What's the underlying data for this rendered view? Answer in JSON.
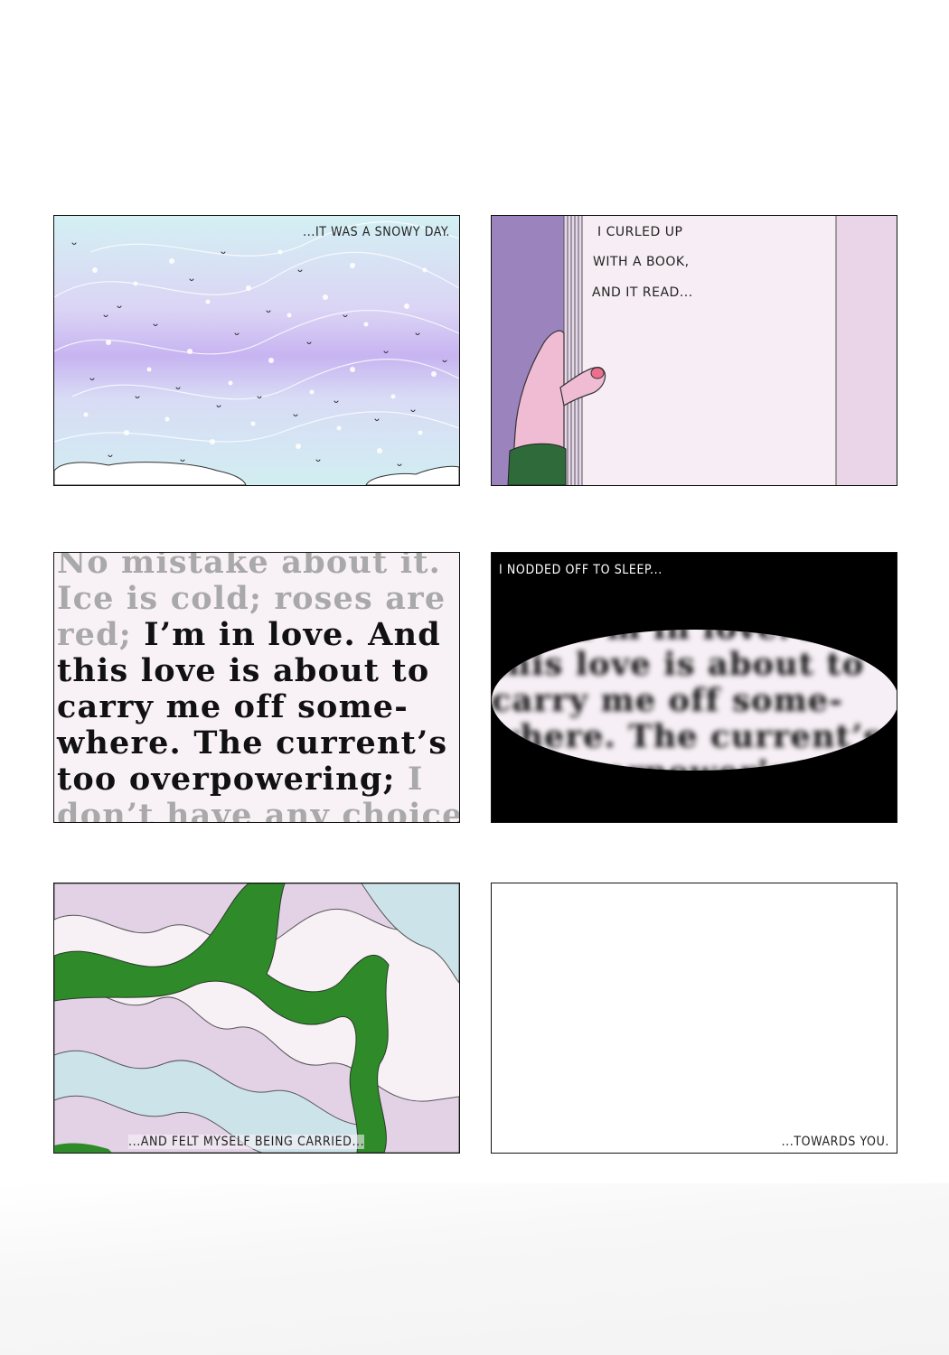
{
  "panels": {
    "snowy": {
      "caption": "...IT WAS A SNOWY DAY."
    },
    "book": {
      "lines": [
        "I CURLED UP",
        "WITH A BOOK,",
        "AND IT READ..."
      ]
    },
    "story": {
      "lines": [
        "No mistake about it.",
        "Ice is cold; roses are",
        "red; I’m in love. And",
        "this love is about to",
        "carry me off  some-",
        "where.  The current’s",
        "too overpowering; I",
        "don’t have any choice"
      ]
    },
    "sleep": {
      "caption": "I NODDED OFF TO SLEEP...",
      "lines": [
        "red; I’m in love. And",
        "this love is about to",
        "carry me off  some-",
        "where.  The current’s",
        "too overpowering; I"
      ]
    },
    "carried": {
      "caption": "...AND FELT MYSELF BEING CARRIED..."
    },
    "towards": {
      "caption": "...TOWARDS YOU."
    }
  },
  "colors": {
    "sky_top": "#d3f0f3",
    "sky_violet": "#c7b4f1",
    "book_violet": "#9b84bd",
    "page_pink": "#f4eaf2",
    "sleeve_green": "#2f6b3a",
    "wave_green": "#2f8a29",
    "wave_pink": "#e3d2e6",
    "wave_blue": "#cde3ea"
  }
}
